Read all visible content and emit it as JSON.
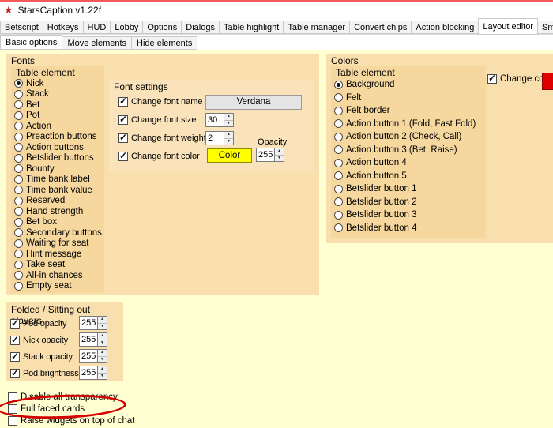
{
  "window": {
    "title": "StarsCaption v1.22f",
    "logo_glyph": "★"
  },
  "main_tabs": {
    "items": [
      "Betscript",
      "Hotkeys",
      "HUD",
      "Lobby",
      "Options",
      "Dialogs",
      "Table highlight",
      "Table manager",
      "Convert chips",
      "Action blocking",
      "Layout editor",
      "Sm"
    ],
    "active_index": 10
  },
  "sub_tabs": {
    "items": [
      "Basic options",
      "Move elements",
      "Hide elements"
    ],
    "active_index": 0
  },
  "fonts": {
    "title": "Fonts",
    "table_element": {
      "title": "Table element",
      "options": [
        "Nick",
        "Stack",
        "Bet",
        "Pot",
        "Action",
        "Preaction buttons",
        "Action buttons",
        "Betslider buttons",
        "Bounty",
        "Time bank label",
        "Time bank value",
        "Reserved",
        "Hand strength",
        "Bet box",
        "Secondary buttons",
        "Waiting for seat",
        "Hint message",
        "Take seat",
        "All-in chances",
        "Empty seat"
      ],
      "selected": "Nick"
    },
    "font_settings": {
      "title": "Font settings",
      "change_font_name": {
        "label": "Change font name",
        "checked": true,
        "value": "Verdana"
      },
      "change_font_size": {
        "label": "Change font size",
        "checked": true,
        "value": "30"
      },
      "change_font_weight": {
        "label": "Change font weight",
        "checked": true,
        "value": "2"
      },
      "change_font_color": {
        "label": "Change font color",
        "checked": true,
        "button_label": "Color",
        "button_color": "#ffff00"
      },
      "opacity": {
        "label": "Opacity",
        "value": "255"
      }
    }
  },
  "colors": {
    "title": "Colors",
    "table_element": {
      "title": "Table element",
      "options": [
        "Background",
        "Felt",
        "Felt border",
        "Action button 1 (Fold, Fast Fold)",
        "Action button 2 (Check, Call)",
        "Action button 3 (Bet, Raise)",
        "Action button 4",
        "Action button 5",
        "Betslider button 1",
        "Betslider button 2",
        "Betslider button 3",
        "Betslider button 4"
      ],
      "selected": "Background"
    },
    "change_color": {
      "label": "Change color",
      "checked": true,
      "swatch_color": "#e00000"
    }
  },
  "folded_panel": {
    "title": "Folded / Sitting out players",
    "rows": [
      {
        "label": "Pod opacity",
        "checked": true,
        "value": "255"
      },
      {
        "label": "Nick opacity",
        "checked": true,
        "value": "255"
      },
      {
        "label": "Stack opacity",
        "checked": true,
        "value": "255"
      },
      {
        "label": "Pod brightness",
        "checked": true,
        "value": "255"
      }
    ]
  },
  "bottom_checkboxes": [
    {
      "label": "Disable all transparency",
      "checked": false
    },
    {
      "label": "Full faced cards",
      "checked": false
    },
    {
      "label": "Raise widgets on top of chat",
      "checked": false
    }
  ],
  "annotation": {
    "type": "red-ellipse",
    "around": "Full faced cards",
    "color": "#d40000"
  },
  "palette": {
    "content_bg": "#ffffd2",
    "group_bg": "#f9deae",
    "inner_panel_bg": "#f6d89f",
    "font_settings_bg": "#fae3ba",
    "titlebar_top_line": "#f05a5a"
  }
}
